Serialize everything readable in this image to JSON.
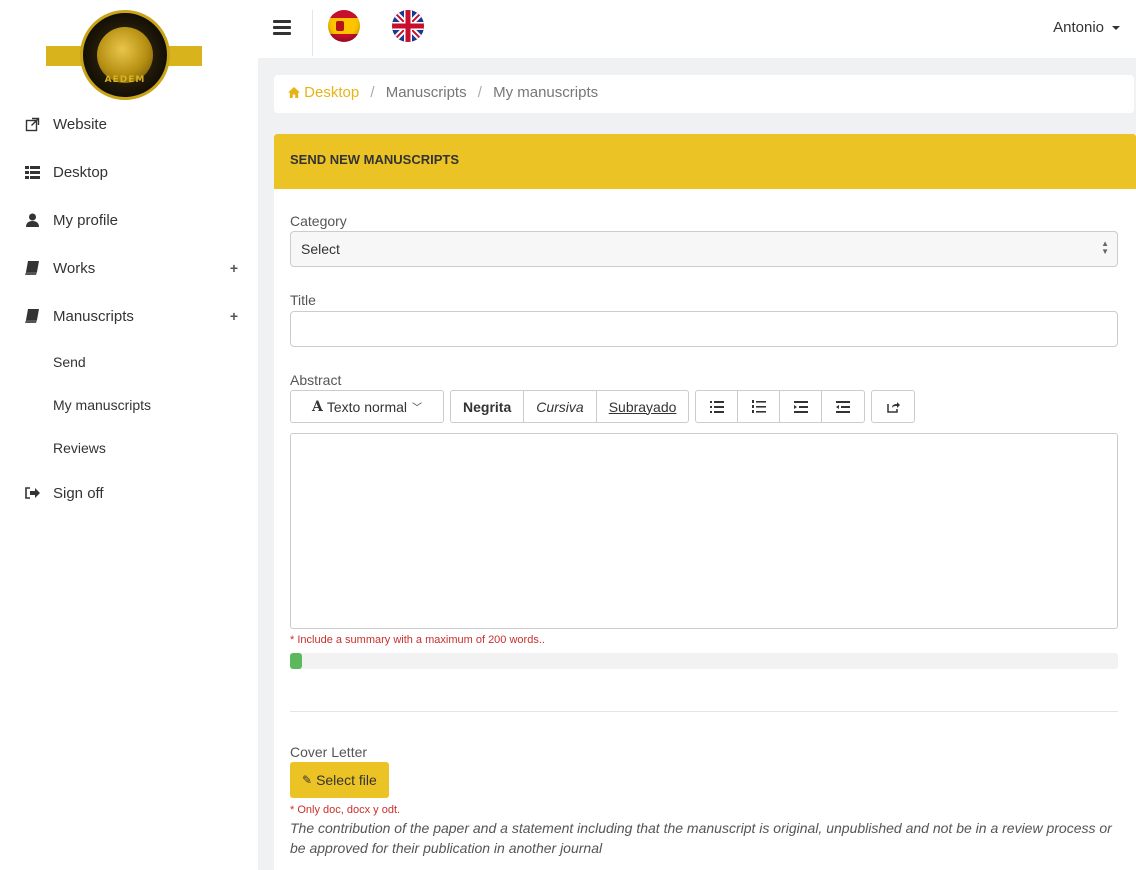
{
  "logo": {
    "text": "AEDEM"
  },
  "sidebar": {
    "items": [
      {
        "label": "Website",
        "icon": "external-link-icon"
      },
      {
        "label": "Desktop",
        "icon": "list-icon"
      },
      {
        "label": "My profile",
        "icon": "user-icon"
      },
      {
        "label": "Works",
        "icon": "book-icon",
        "expand": "+"
      },
      {
        "label": "Manuscripts",
        "icon": "book-icon",
        "expand": "+"
      }
    ],
    "subitems": [
      {
        "label": "Send"
      },
      {
        "label": "My manuscripts"
      },
      {
        "label": "Reviews"
      }
    ],
    "signoff": {
      "label": "Sign off",
      "icon": "sign-out-icon"
    }
  },
  "topbar": {
    "user": "Antonio"
  },
  "breadcrumb": {
    "home": "Desktop",
    "section": "Manuscripts",
    "current": "My manuscripts"
  },
  "panel": {
    "title": "SEND NEW MANUSCRIPTS"
  },
  "form": {
    "category_label": "Category",
    "category_value": "Select",
    "title_label": "Title",
    "abstract_label": "Abstract",
    "toolbar": {
      "font_style": "Texto normal",
      "bold": "Negrita",
      "italic": "Cursiva",
      "underline": "Subrayado"
    },
    "abstract_hint": "* Include a summary with a maximum of 200 words..",
    "progress_fraction": 0.012,
    "cover_label": "Cover Letter",
    "select_file": "Select file",
    "file_hint": "* Only doc, docx y odt.",
    "cover_note": "The contribution of the paper and a statement including that the manuscript is original, unpublished and not be in a review process or be approved for their publication in another journal"
  },
  "colors": {
    "accent": "#ecc325",
    "link": "#e7b418",
    "warn": "#c9302c",
    "progress": "#5cb85c"
  }
}
